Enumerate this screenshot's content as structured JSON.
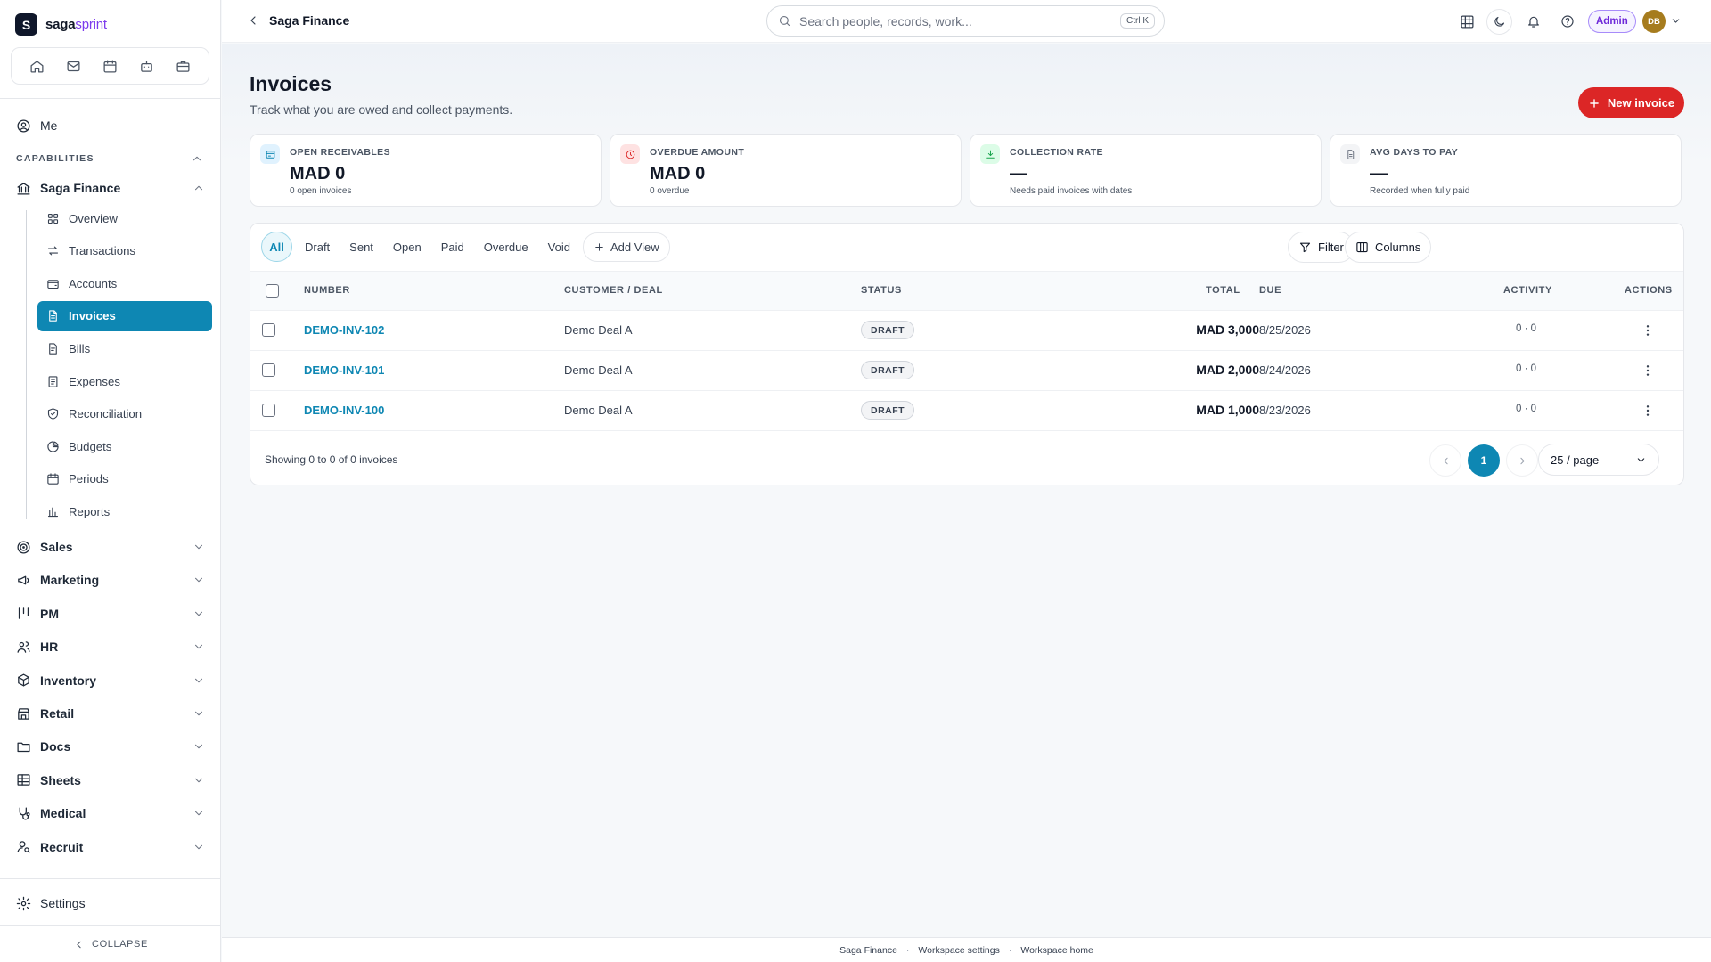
{
  "brand": {
    "part1": "saga",
    "part2": "sprint"
  },
  "sidebar": {
    "me": "Me",
    "capabilities_label": "CAPABILITIES",
    "saga_finance": "Saga Finance",
    "sub_items": [
      {
        "label": "Overview",
        "icon": "grid-icon"
      },
      {
        "label": "Transactions",
        "icon": "arrows-icon"
      },
      {
        "label": "Accounts",
        "icon": "wallet-icon"
      },
      {
        "label": "Invoices",
        "icon": "file-icon",
        "active": true
      },
      {
        "label": "Bills",
        "icon": "receipt-icon"
      },
      {
        "label": "Expenses",
        "icon": "doc-dollar-icon"
      },
      {
        "label": "Reconciliation",
        "icon": "shield-icon"
      },
      {
        "label": "Budgets",
        "icon": "pie-icon"
      },
      {
        "label": "Periods",
        "icon": "calendar-icon"
      },
      {
        "label": "Reports",
        "icon": "bar-chart-icon"
      }
    ],
    "groups": [
      "Sales",
      "Marketing",
      "PM",
      "HR",
      "Inventory",
      "Retail",
      "Docs",
      "Sheets",
      "Medical",
      "Recruit"
    ],
    "settings": "Settings",
    "collapse": "COLLAPSE"
  },
  "topbar": {
    "title": "Saga Finance",
    "search_placeholder": "Search people, records, work...",
    "shortcut": "Ctrl K",
    "admin": "Admin",
    "avatar_initials": "DB"
  },
  "page": {
    "title": "Invoices",
    "subtitle": "Track what you are owed and collect payments.",
    "new_button": "New invoice"
  },
  "kpis": [
    {
      "label": "OPEN RECEIVABLES",
      "value": "MAD 0",
      "note": "0 open invoices",
      "color": "#0e87b3",
      "bg": "#e0f2fe",
      "icon": "card-icon"
    },
    {
      "label": "OVERDUE AMOUNT",
      "value": "MAD 0",
      "note": "0 overdue",
      "color": "#dc2626",
      "bg": "#fee2e2",
      "icon": "clock-alert-icon"
    },
    {
      "label": "COLLECTION RATE",
      "value": "—",
      "note": "Needs paid invoices with dates",
      "color": "#16a34a",
      "bg": "#dcfce7",
      "icon": "download-icon"
    },
    {
      "label": "AVG DAYS TO PAY",
      "value": "—",
      "note": "Recorded when fully paid",
      "color": "#6b7280",
      "bg": "#f3f4f6",
      "icon": "doc-icon"
    }
  ],
  "tabs": [
    "All",
    "Draft",
    "Sent",
    "Open",
    "Paid",
    "Overdue",
    "Void"
  ],
  "add_view": "Add View",
  "toolbar": {
    "filter": "Filter",
    "columns": "Columns"
  },
  "table": {
    "headers": {
      "number": "NUMBER",
      "customer": "CUSTOMER / DEAL",
      "status": "STATUS",
      "total": "TOTAL",
      "due": "DUE",
      "activity": "ACTIVITY",
      "actions": "ACTIONS"
    },
    "rows": [
      {
        "number": "DEMO-INV-102",
        "customer": "Demo Deal A",
        "status": "DRAFT",
        "total": "MAD 3,000",
        "due": "8/25/2026",
        "activity": "0 · 0"
      },
      {
        "number": "DEMO-INV-101",
        "customer": "Demo Deal A",
        "status": "DRAFT",
        "total": "MAD 2,000",
        "due": "8/24/2026",
        "activity": "0 · 0"
      },
      {
        "number": "DEMO-INV-100",
        "customer": "Demo Deal A",
        "status": "DRAFT",
        "total": "MAD 1,000",
        "due": "8/23/2026",
        "activity": "0 · 0"
      }
    ]
  },
  "pagination": {
    "summary": "Showing 0 to 0 of 0 invoices",
    "current_page": "1",
    "per_page": "25 / page"
  },
  "footer": {
    "links": [
      "Saga Finance",
      "Workspace settings",
      "Workspace home"
    ]
  }
}
